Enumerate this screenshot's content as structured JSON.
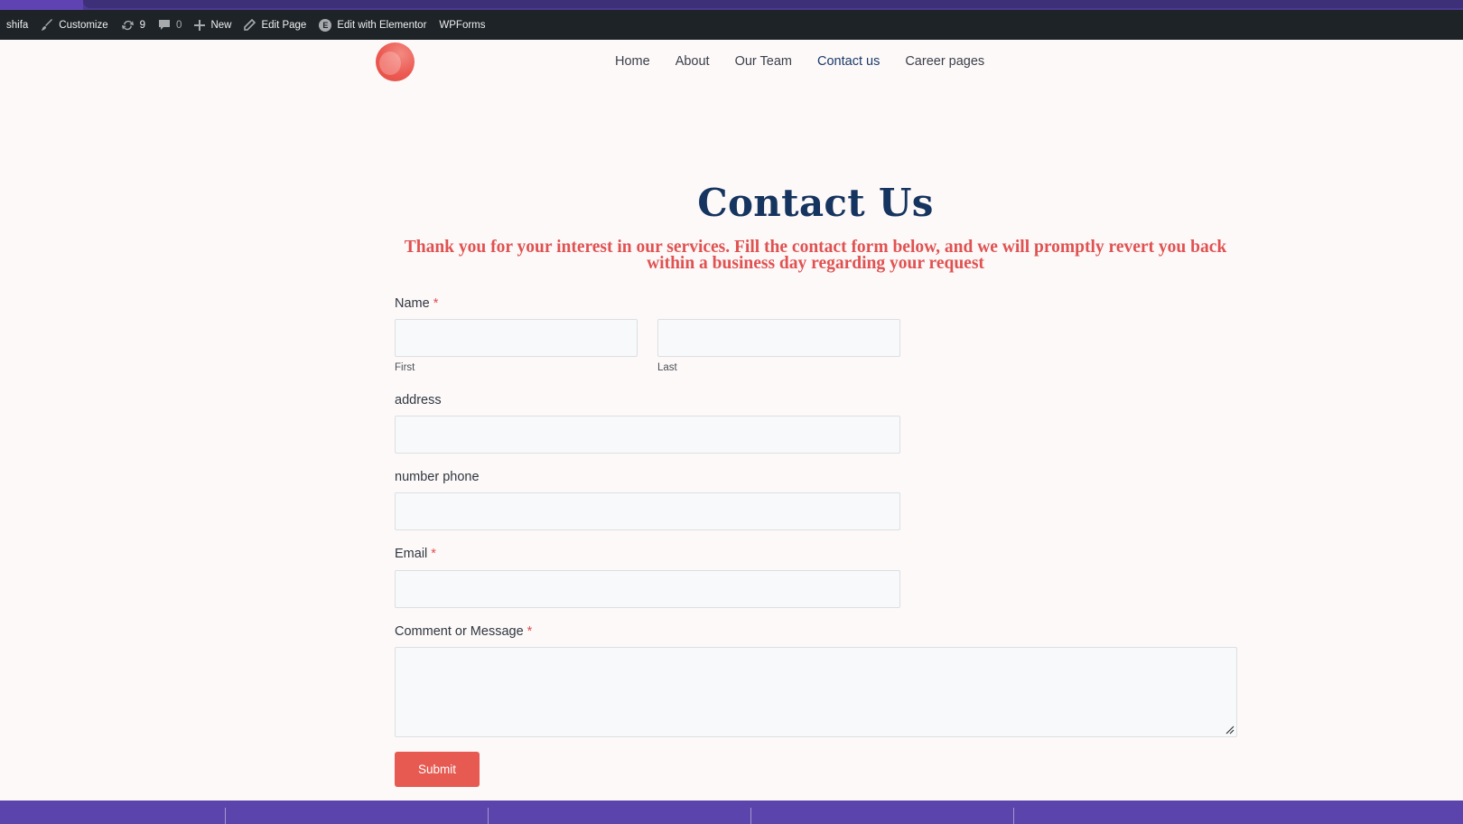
{
  "admin_bar": {
    "site_name": "shifa",
    "customize_label": "Customize",
    "updates_count": "9",
    "comments_count": "0",
    "new_label": "New",
    "edit_page_label": "Edit Page",
    "elementor_label": "Edit with Elementor",
    "wpforms_label": "WPForms"
  },
  "nav": {
    "items": [
      {
        "label": "Home"
      },
      {
        "label": "About"
      },
      {
        "label": "Our Team"
      },
      {
        "label": "Contact us",
        "active": true
      },
      {
        "label": "Career pages"
      }
    ]
  },
  "page": {
    "title": "Contact Us",
    "intro": "Thank you for your interest in our services. Fill the contact form below, and we will promptly revert you back within a business day regarding your request"
  },
  "form": {
    "name_label": "Name",
    "required_marker": "*",
    "first_sublabel": "First",
    "last_sublabel": "Last",
    "first_value": "",
    "last_value": "",
    "address_label": "address",
    "address_value": "",
    "phone_label": "number phone",
    "phone_value": "",
    "email_label": "Email",
    "email_value": "",
    "message_label": "Comment or Message",
    "message_value": "",
    "submit_label": "Submit"
  },
  "colors": {
    "accent": "#e65a52",
    "title": "#15345f",
    "admin_bar": "#1d2327",
    "footer": "#5b44ab"
  }
}
